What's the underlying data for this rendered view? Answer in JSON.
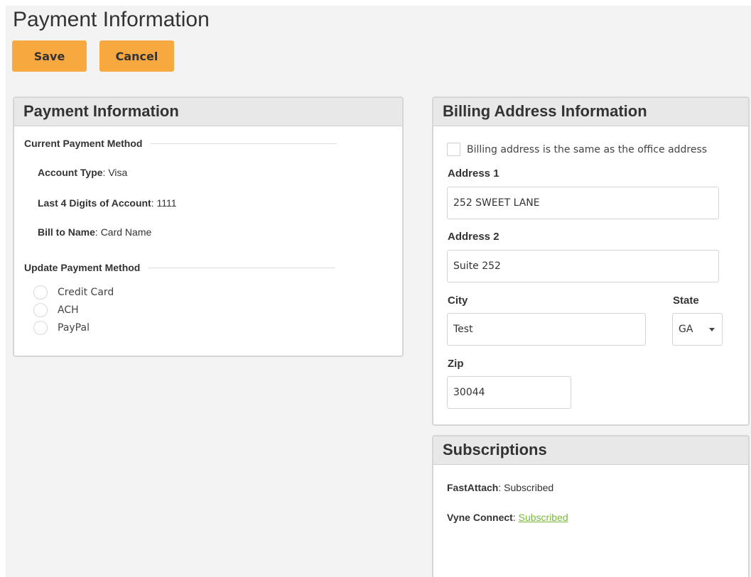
{
  "page": {
    "title": "Payment Information"
  },
  "toolbar": {
    "save_label": "Save",
    "cancel_label": "Cancel"
  },
  "payment": {
    "header": "Payment Information",
    "current_heading": "Current Payment Method",
    "account_type_label": "Account Type",
    "account_type_value": "Visa",
    "last4_label": "Last 4 Digits of Account",
    "last4_value": "1111",
    "bill_to_label": "Bill to Name",
    "bill_to_value": "Card Name",
    "update_heading": "Update Payment Method",
    "methods": [
      {
        "label": "Credit Card"
      },
      {
        "label": "ACH"
      },
      {
        "label": "PayPal"
      }
    ]
  },
  "billing": {
    "header": "Billing Address Information",
    "same_as_office_label": "Billing address is the same as the office address",
    "address1_label": "Address 1",
    "address1_value": "252 SWEET LANE",
    "address2_label": "Address 2",
    "address2_value": "Suite 252",
    "city_label": "City",
    "city_value": "Test",
    "state_label": "State",
    "state_value": "GA",
    "zip_label": "Zip",
    "zip_value": "30044"
  },
  "subscriptions": {
    "header": "Subscriptions",
    "items": [
      {
        "name": "FastAttach",
        "status": "Subscribed"
      },
      {
        "name": "Vyne Connect",
        "status": "Subscribed"
      }
    ]
  },
  "colors": {
    "accent_button": "#f7a93f",
    "link_green": "#78b83a",
    "page_background": "#f3f3f3",
    "panel_header": "#e8e8e8"
  },
  "icons": {
    "radio": "radio-unchecked-icon",
    "checkbox": "checkbox-unchecked-icon",
    "select_caret": "caret-down-icon"
  }
}
